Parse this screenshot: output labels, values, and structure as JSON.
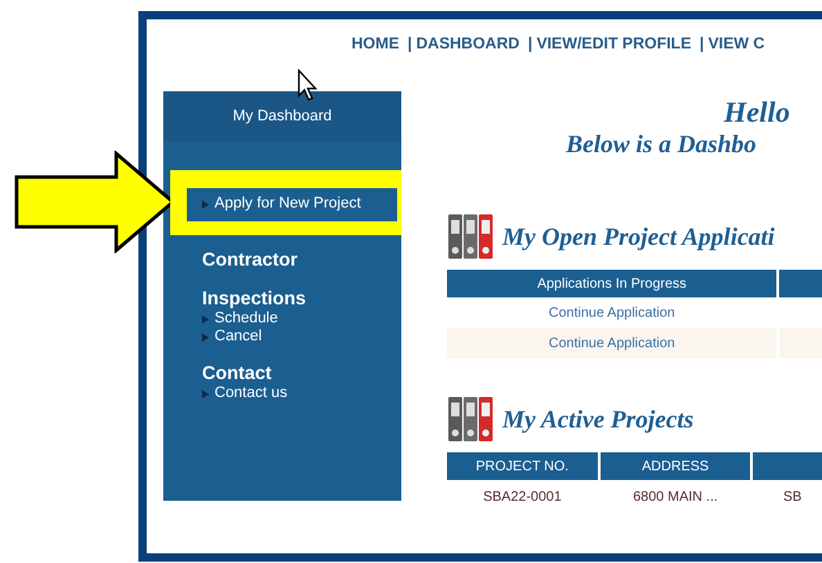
{
  "nav": [
    {
      "kind": "link",
      "label": "HOME"
    },
    {
      "kind": "separator",
      "label": "|"
    },
    {
      "kind": "link",
      "label": "DASHBOARD"
    },
    {
      "kind": "separator",
      "label": "|"
    },
    {
      "kind": "link",
      "label": "VIEW/EDIT PROFILE"
    },
    {
      "kind": "separator",
      "label": "|"
    },
    {
      "kind": "link",
      "label": "VIEW C"
    }
  ],
  "sidebar": {
    "title": "My Dashboard",
    "groups": [
      {
        "items": [
          "Apply for New Project"
        ]
      },
      {
        "heading": "Contractor"
      },
      {
        "heading": "Inspections",
        "items": [
          "Schedule",
          "Cancel"
        ]
      },
      {
        "heading": "Contact",
        "items": [
          "Contact us"
        ]
      }
    ]
  },
  "greeting": "Hello",
  "subtitle": "Below is a Dashbo",
  "sections": [
    {
      "title": "My Open Project Applicati",
      "kind": "links",
      "columns": [
        "Applications In Progress",
        ""
      ],
      "rows": [
        [
          "Continue Application"
        ],
        [
          "Continue Application"
        ]
      ]
    },
    {
      "title": "My Active Projects",
      "kind": "plain",
      "columns": [
        "PROJECT NO.",
        "ADDRESS",
        ""
      ],
      "rows": [
        [
          "SBA22-0001",
          "6800 MAIN ...",
          "SB"
        ]
      ]
    }
  ]
}
